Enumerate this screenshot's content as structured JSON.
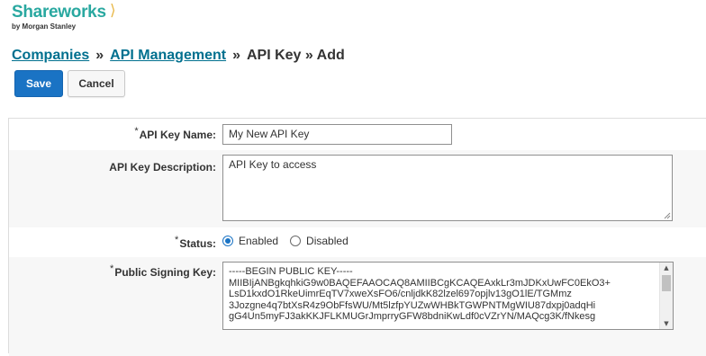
{
  "brand": {
    "name": "Shareworks",
    "byline": "by Morgan Stanley",
    "accent_color": "#29a8a0",
    "chevron": "⟩"
  },
  "breadcrumb": {
    "link1": "Companies",
    "sep1": "»",
    "link2": "API Management",
    "sep2": "»",
    "current": "API Key » Add"
  },
  "toolbar": {
    "save_label": "Save",
    "cancel_label": "Cancel"
  },
  "form": {
    "required_marker": "*",
    "api_key_name": {
      "label": "API Key Name:",
      "value": "My New API Key"
    },
    "api_key_description": {
      "label": "API Key Description:",
      "value": "API Key to access"
    },
    "status": {
      "label": "Status:",
      "options": [
        "Enabled",
        "Disabled"
      ],
      "selected": "Enabled"
    },
    "public_signing_key": {
      "label": "Public Signing Key:",
      "value": "-----BEGIN PUBLIC KEY-----\nMIIBIjANBgkqhkiG9w0BAQEFAAOCAQ8AMIIBCgKCAQEAxkLr3mJDKxUwFC0EkO3+\nLsD1kxdO1RkeUimrEqTV7xweXsFO6/cnljdkK82lzel697opjlv13gO1lE/TGMmz\n3Jozgne4q7btXsR4z9ObFfsWU/Mt5lzfpYUZwWHBkTGWPNTMgWIU87dxpj0adqHi\ngG4Un5myFJ3akKKJFLKMUGrJmprryGFW8bdniKwLdf0cVZrYN/MAQcg3K/fNkesg"
    }
  },
  "colors": {
    "link": "#00708f",
    "primary_button": "#1a73c4",
    "row_alt": "#f7f7f7",
    "border": "#dddddd"
  }
}
